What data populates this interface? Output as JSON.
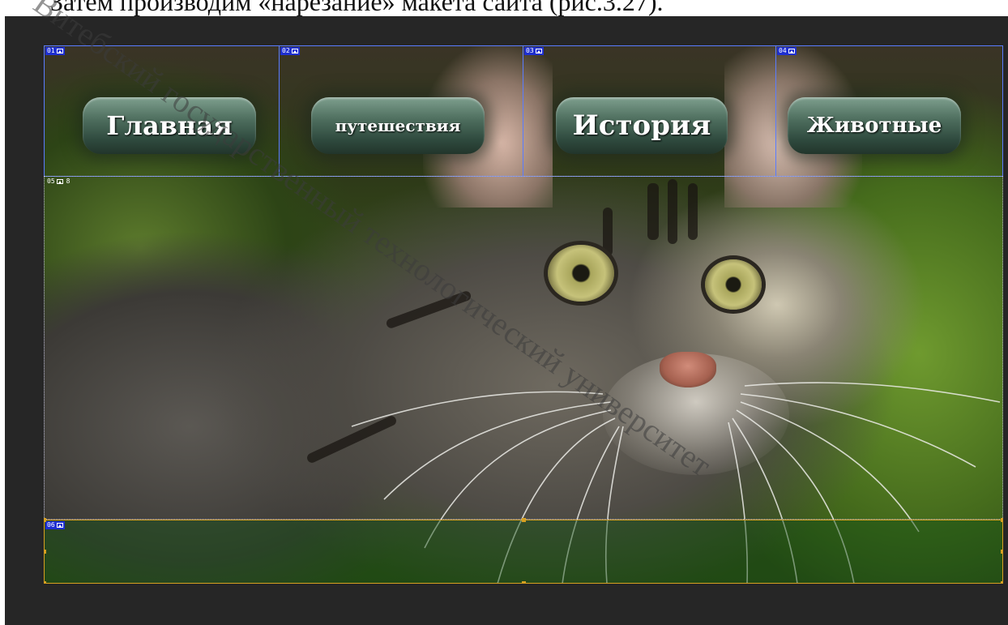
{
  "caption": {
    "text": "Затем производим «нарезание» макета сайта (рис.3.27).",
    "watermark": "Витебский государственный технологический университет"
  },
  "nav": [
    {
      "label": "Главная"
    },
    {
      "label": "путешествия"
    },
    {
      "label": "История"
    },
    {
      "label": "Животные"
    }
  ],
  "slices": [
    {
      "number": "01",
      "type": "user"
    },
    {
      "number": "02",
      "type": "user"
    },
    {
      "number": "03",
      "type": "user"
    },
    {
      "number": "04",
      "type": "user"
    },
    {
      "number": "05",
      "type": "auto",
      "badge": "8"
    },
    {
      "number": "06",
      "type": "selected"
    }
  ],
  "colors": {
    "workspace": "#262626",
    "slice_border": "#5a7cff",
    "slice_tag": "#1e2fd0",
    "selected_border": "#d7a020"
  }
}
